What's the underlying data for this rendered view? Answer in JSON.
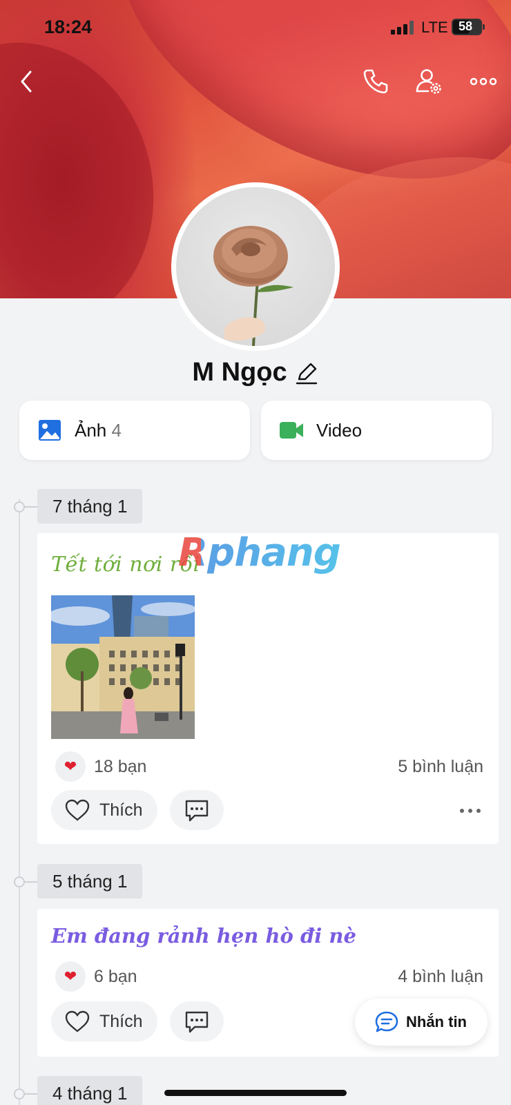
{
  "status_bar": {
    "time": "18:24",
    "network": "LTE",
    "battery": "58"
  },
  "profile": {
    "name": "M Ngọc"
  },
  "media": {
    "photos_label": "Ảnh",
    "photos_count": "4",
    "video_label": "Video"
  },
  "watermark": "Rphang",
  "posts": [
    {
      "date": "7 tháng 1",
      "caption": "Tết tới nơi rồi",
      "reactions": "18 bạn",
      "comments": "5 bình luận",
      "like_label": "Thích"
    },
    {
      "date": "5 tháng 1",
      "caption": "Em đang rảnh hẹn hò đi nè",
      "reactions": "6 bạn",
      "comments": "4 bình luận",
      "like_label": "Thích"
    },
    {
      "date": "4 tháng 1"
    }
  ],
  "message_button": {
    "label": "Nhắn tin"
  },
  "colors": {
    "accent_blue": "#1f6fe0",
    "video_green": "#3bb05a",
    "caption1_color": "#6fae3c",
    "caption2_color": "#7a5ce0",
    "heart": "#e02030"
  }
}
